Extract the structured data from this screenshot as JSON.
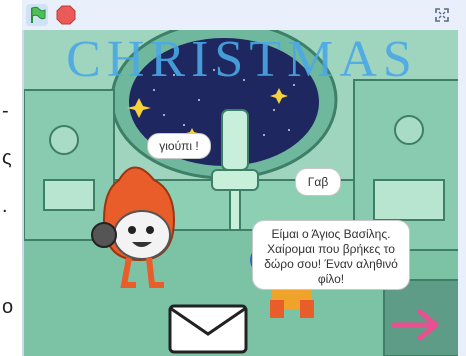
{
  "left_fragment": {
    "line1": "-",
    "line2": "ς",
    "line3": ".",
    "line4": "ο"
  },
  "stage": {
    "title": "CHRISTMAS",
    "bubbles": {
      "cat": "γιούπι !",
      "dog": "Γαβ",
      "santa": "Είμαι ο Άγιος Βασίλης. Χαίρομαι που βρήκες το δώρο σου! Έναν αληθινό φίλο!"
    }
  },
  "icons": {
    "flag": "green-flag-icon",
    "stop": "stop-icon",
    "fullscreen": "fullscreen-icon",
    "envelope": "envelope-icon",
    "arrow": "arrow-right-icon"
  },
  "colors": {
    "stage_bg": "#9fd5bf",
    "title": "#4aa8e6",
    "flag": "#4cbf56",
    "stop": "#ec5959",
    "arrow": "#e8508f",
    "toolbar_bg": "#e9f0fb"
  }
}
